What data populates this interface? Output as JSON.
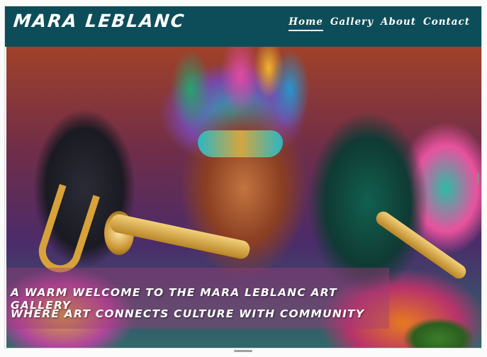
{
  "brand": {
    "name": "MARA LEBLANC"
  },
  "nav": {
    "items": [
      {
        "label": "Home",
        "active": true
      },
      {
        "label": "Gallery",
        "active": false
      },
      {
        "label": "About",
        "active": false
      },
      {
        "label": "Contact",
        "active": false
      }
    ]
  },
  "hero": {
    "line1": "A WARM WELCOME TO THE MARA LEBLANC ART GALLERY",
    "line2": "WHERE ART CONNECTS CULTURE WITH COMMUNITY"
  },
  "colors": {
    "header_bg": "#0d4d59",
    "text": "#ffffff",
    "caption_bg": "rgba(160,60,120,0.42)"
  }
}
